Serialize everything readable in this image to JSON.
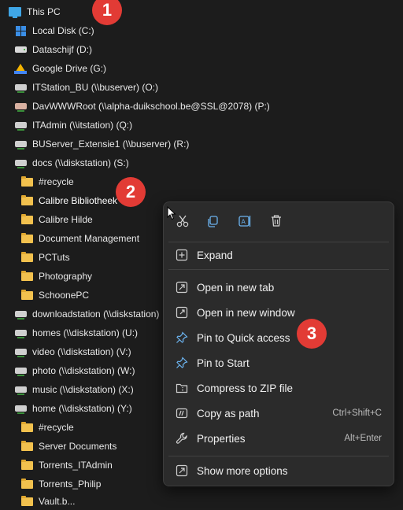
{
  "tree": {
    "items": [
      {
        "label": "This PC",
        "icon": "this-pc-icon"
      },
      {
        "label": "Local Disk (C:)",
        "icon": "windows-drive-icon"
      },
      {
        "label": "Dataschijf (D:)",
        "icon": "drive-icon"
      },
      {
        "label": "Google Drive (G:)",
        "icon": "google-drive-icon"
      },
      {
        "label": "ITStation_BU (\\\\buserver) (O:)",
        "icon": "network-drive-icon"
      },
      {
        "label": "DavWWWRoot (\\\\alpha-duikschool.be@SSL@2078) (P:)",
        "icon": "network-drive-icon"
      },
      {
        "label": "ITAdmin (\\\\itstation) (Q:)",
        "icon": "network-drive-icon"
      },
      {
        "label": "BUServer_Extensie1 (\\\\buserver) (R:)",
        "icon": "network-drive-icon"
      },
      {
        "label": "docs (\\\\diskstation) (S:)",
        "icon": "network-drive-icon"
      },
      {
        "label": "#recycle",
        "icon": "folder-icon"
      },
      {
        "label": "Calibre Bibliotheek",
        "icon": "folder-icon"
      },
      {
        "label": "Calibre Hilde",
        "icon": "folder-icon"
      },
      {
        "label": "Document Management",
        "icon": "folder-icon"
      },
      {
        "label": "PCTuts",
        "icon": "folder-icon"
      },
      {
        "label": "Photography",
        "icon": "folder-icon"
      },
      {
        "label": "SchoonePC",
        "icon": "folder-icon"
      },
      {
        "label": "downloadstation (\\\\diskstation)",
        "icon": "network-drive-icon"
      },
      {
        "label": "homes (\\\\diskstation) (U:)",
        "icon": "network-drive-icon"
      },
      {
        "label": "video (\\\\diskstation) (V:)",
        "icon": "network-drive-icon"
      },
      {
        "label": "photo (\\\\diskstation) (W:)",
        "icon": "network-drive-icon"
      },
      {
        "label": "music (\\\\diskstation) (X:)",
        "icon": "network-drive-icon"
      },
      {
        "label": "home (\\\\diskstation) (Y:)",
        "icon": "network-drive-icon"
      },
      {
        "label": "#recycle",
        "icon": "folder-icon"
      },
      {
        "label": "Server Documents",
        "icon": "folder-icon"
      },
      {
        "label": "Torrents_ITAdmin",
        "icon": "folder-icon"
      },
      {
        "label": "Torrents_Philip",
        "icon": "folder-icon"
      },
      {
        "label": "Vault.b...",
        "icon": "folder-icon"
      }
    ]
  },
  "badges": {
    "one": "1",
    "two": "2",
    "three": "3"
  },
  "context_menu": {
    "toolbar": [
      "cut-icon",
      "copy-icon",
      "rename-icon",
      "delete-icon"
    ],
    "items": [
      {
        "label": "Expand",
        "icon": "expand-icon",
        "shortcut": ""
      },
      {
        "label": "Open in new tab",
        "icon": "new-tab-icon",
        "shortcut": ""
      },
      {
        "label": "Open in new window",
        "icon": "new-window-icon",
        "shortcut": ""
      },
      {
        "label": "Pin to Quick access",
        "icon": "pin-icon",
        "shortcut": ""
      },
      {
        "label": "Pin to Start",
        "icon": "pin-icon",
        "shortcut": ""
      },
      {
        "label": "Compress to ZIP file",
        "icon": "zip-icon",
        "shortcut": ""
      },
      {
        "label": "Copy as path",
        "icon": "copy-path-icon",
        "shortcut": "Ctrl+Shift+C"
      },
      {
        "label": "Properties",
        "icon": "wrench-icon",
        "shortcut": "Alt+Enter"
      },
      {
        "label": "Show more options",
        "icon": "more-options-icon",
        "shortcut": ""
      }
    ]
  },
  "colors": {
    "accent": "#3a8ee6",
    "badge": "#e23b35",
    "folder": "#f2c14e",
    "background": "#1c1c1c",
    "menu": "#2b2b2b"
  }
}
